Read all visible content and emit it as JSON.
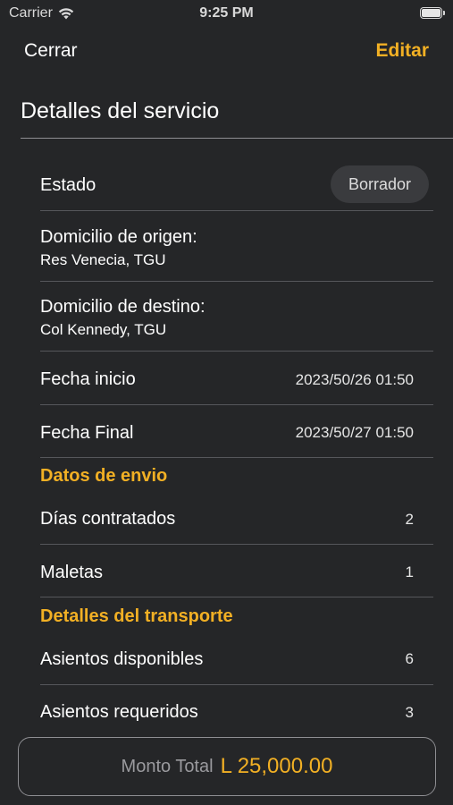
{
  "status_bar": {
    "carrier": "Carrier",
    "time": "9:25 PM"
  },
  "nav": {
    "close_label": "Cerrar",
    "edit_label": "Editar"
  },
  "page_title": "Detalles del servicio",
  "estado": {
    "label": "Estado",
    "value": "Borrador"
  },
  "origen": {
    "label": "Domicilio de origen:",
    "value": "Res Venecia, TGU"
  },
  "destino": {
    "label": "Domicilio de destino:",
    "value": "Col Kennedy, TGU"
  },
  "fecha_inicio": {
    "label": "Fecha inicio",
    "value": "2023/50/26 01:50"
  },
  "fecha_final": {
    "label": "Fecha Final",
    "value": "2023/50/27 01:50"
  },
  "datos_envio": {
    "header": "Datos de envio",
    "dias": {
      "label": "Días contratados",
      "value": "2"
    },
    "maletas": {
      "label": "Maletas",
      "value": "1"
    }
  },
  "transporte": {
    "header": "Detalles del transporte",
    "disponibles": {
      "label": "Asientos disponibles",
      "value": "6"
    },
    "requeridos": {
      "label": "Asientos requeridos",
      "value": "3"
    }
  },
  "footer": {
    "total_label": "Monto Total",
    "total_amount": "L 25,000.00"
  },
  "colors": {
    "background": "#252628",
    "accent": "#f2b024"
  }
}
